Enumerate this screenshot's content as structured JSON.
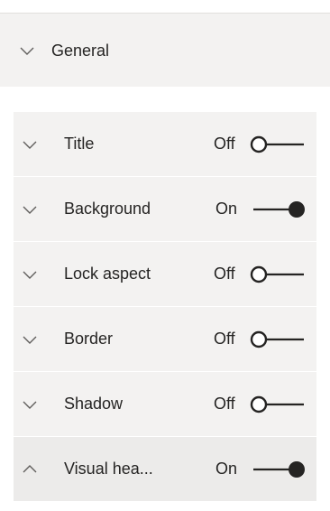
{
  "general": {
    "label": "General",
    "expanded": false
  },
  "properties": [
    {
      "label": "Title",
      "state": "Off",
      "on": false,
      "expanded": false
    },
    {
      "label": "Background",
      "state": "On",
      "on": true,
      "expanded": false
    },
    {
      "label": "Lock aspect",
      "state": "Off",
      "on": false,
      "expanded": false
    },
    {
      "label": "Border",
      "state": "Off",
      "on": false,
      "expanded": false
    },
    {
      "label": "Shadow",
      "state": "Off",
      "on": false,
      "expanded": false
    },
    {
      "label": "Visual hea...",
      "state": "On",
      "on": true,
      "expanded": true
    }
  ],
  "icons": {
    "collapsed": "chevron-down-icon",
    "expanded": "chevron-up-icon"
  },
  "colors": {
    "panel_bg": "#f3f2f1",
    "expanded_bg": "#ecebea",
    "toggle": "#252423",
    "text": "#252423"
  }
}
